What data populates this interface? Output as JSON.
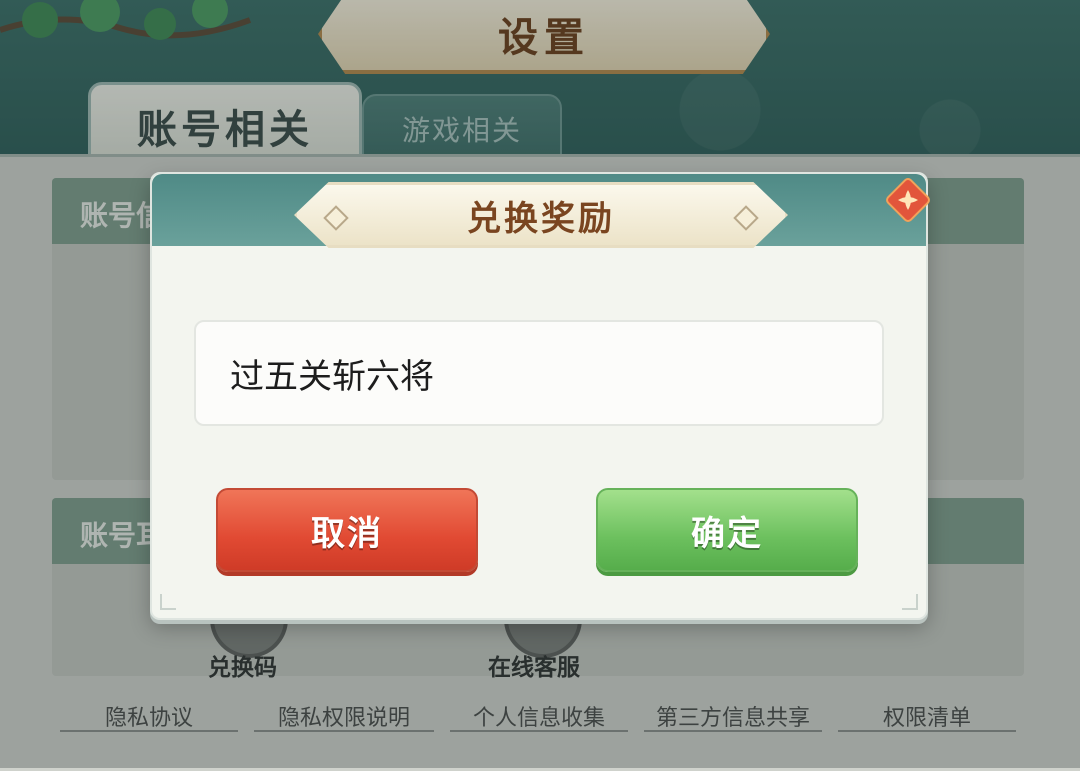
{
  "window": {
    "title": "设置"
  },
  "tabs": [
    {
      "label": "账号相关",
      "active": true
    },
    {
      "label": "游戏相关",
      "active": false
    }
  ],
  "sections": [
    {
      "title_partial": "账号信"
    },
    {
      "title_partial": "账号耳"
    }
  ],
  "shortcuts": [
    {
      "label": "兑换码",
      "icon": "redeem-icon"
    },
    {
      "label": "在线客服",
      "icon": "customer-service-icon"
    }
  ],
  "footer_links": [
    "隐私协议",
    "隐私权限说明",
    "个人信息收集",
    "第三方信息共享",
    "权限清单"
  ],
  "dialog": {
    "title": "兑换奖励",
    "input_value": "过五关斩六将",
    "cancel_label": "取消",
    "confirm_label": "确定"
  },
  "colors": {
    "cancel": "#e14a33",
    "confirm": "#6cc05e",
    "header": "#4f8a86"
  }
}
